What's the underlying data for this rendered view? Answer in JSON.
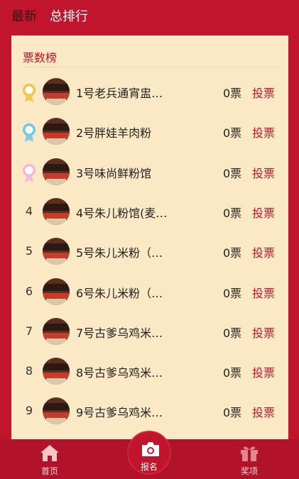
{
  "header": {
    "tabs": [
      {
        "label": "最新"
      },
      {
        "label": "总排行"
      }
    ]
  },
  "panel": {
    "title": "票数榜",
    "vote_label": "投票",
    "rows": [
      {
        "rank": "1",
        "medal": "gold",
        "name": "1号老兵通宵盅…",
        "votes": "0票"
      },
      {
        "rank": "2",
        "medal": "silver",
        "name": "2号胖娃羊肉粉",
        "votes": "0票"
      },
      {
        "rank": "3",
        "medal": "bronze",
        "name": "3号味尚鲜粉馆",
        "votes": "0票"
      },
      {
        "rank": "4",
        "medal": null,
        "name": "4号朱儿粉馆(麦…",
        "votes": "0票"
      },
      {
        "rank": "5",
        "medal": null,
        "name": "5号朱儿米粉（…",
        "votes": "0票"
      },
      {
        "rank": "6",
        "medal": null,
        "name": "6号朱儿米粉（…",
        "votes": "0票"
      },
      {
        "rank": "7",
        "medal": null,
        "name": "7号古爹乌鸡米…",
        "votes": "0票"
      },
      {
        "rank": "8",
        "medal": null,
        "name": "8号古爹乌鸡米…",
        "votes": "0票"
      },
      {
        "rank": "9",
        "medal": null,
        "name": "9号古爹乌鸡米…",
        "votes": "0票"
      }
    ]
  },
  "bottom_nav": {
    "home_label": "首页",
    "signup_label": "报名",
    "prize_label": "奖项"
  },
  "colors": {
    "brand_red": "#c1152d",
    "panel_bg": "#fbe8c4",
    "medal_gold": "#f2c14e",
    "medal_silver": "#6ec6ea",
    "medal_bronze": "#f3b8d8"
  },
  "icons": {
    "medal": "medal-icon",
    "home": "home-icon",
    "camera": "camera-icon",
    "gift": "gift-icon"
  }
}
